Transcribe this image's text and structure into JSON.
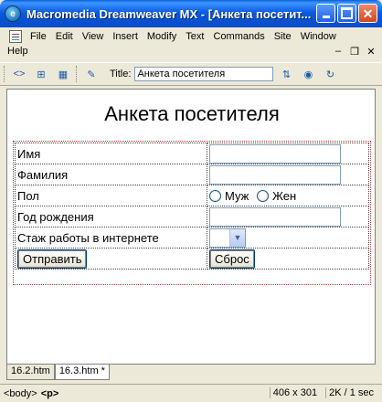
{
  "window": {
    "title": "Macromedia Dreamweaver MX - [Анкета посетит...",
    "app_icon_letter": "e"
  },
  "menu": {
    "items": [
      "File",
      "Edit",
      "View",
      "Insert",
      "Modify",
      "Text",
      "Commands",
      "Site",
      "Window"
    ],
    "second_row": "Help"
  },
  "toolbar": {
    "title_label": "Title:",
    "title_value": "Анкета посетителя"
  },
  "document": {
    "heading": "Анкета посетителя",
    "rows": [
      {
        "label": "Имя"
      },
      {
        "label": "Фамилия"
      },
      {
        "label": "Пол"
      },
      {
        "label": "Год рождения"
      },
      {
        "label": "Стаж работы в интернете"
      }
    ],
    "gender_options": [
      "Муж",
      "Жен"
    ],
    "submit_label": "Отправить",
    "reset_label": "Сброс"
  },
  "tabs": [
    "16.2.htm",
    "16.3.htm *"
  ],
  "status": {
    "tag_body": "<body>",
    "tag_p": "<p>",
    "dimensions": "406 x 301",
    "size_time": "2K / 1 sec"
  }
}
